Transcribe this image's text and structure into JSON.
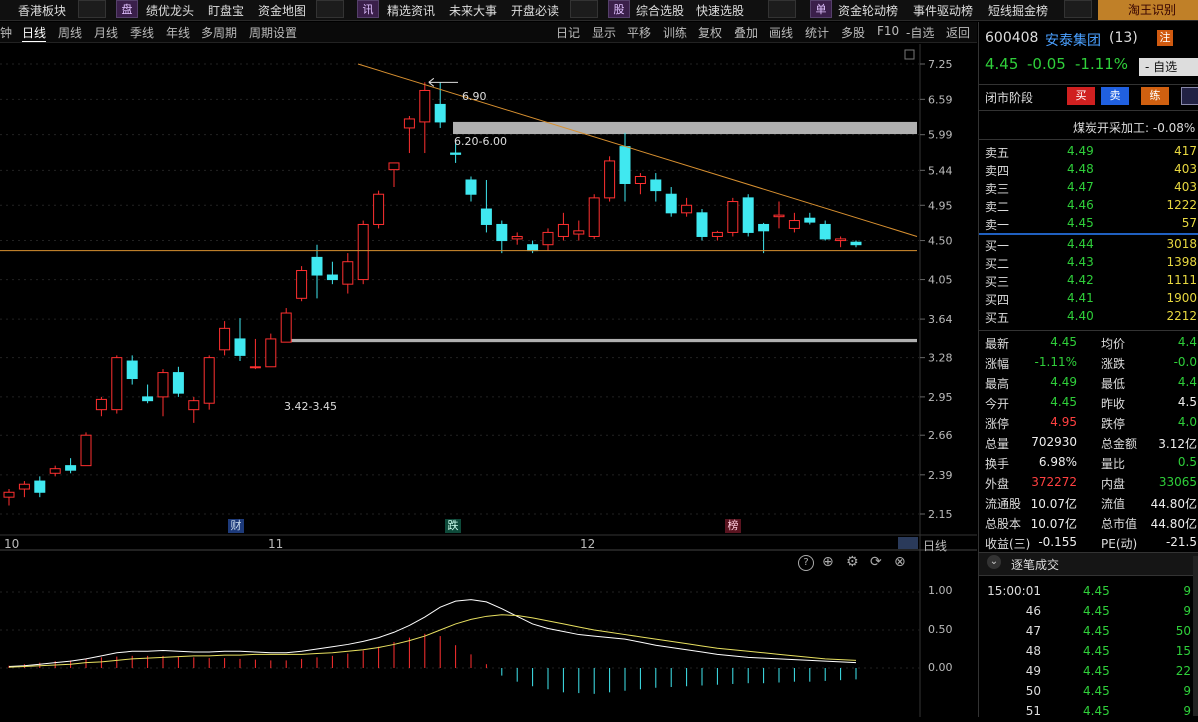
{
  "topbar": {
    "items": [
      {
        "label": "香港板块"
      },
      {
        "badge": "盘",
        "label": "绩优龙头"
      },
      {
        "label": "盯盘宝"
      },
      {
        "label": "资金地图"
      },
      {
        "badge": "讯",
        "label": "精选资讯"
      },
      {
        "label": "未来大事"
      },
      {
        "label": "开盘必读"
      },
      {
        "badge": "股",
        "label": "综合选股"
      },
      {
        "label": "快速选股"
      },
      {
        "badge": "单",
        "label": "资金轮动榜"
      },
      {
        "label": "事件驱动榜"
      },
      {
        "label": "短线掘金榜"
      },
      {
        "label": "淘王识别"
      }
    ]
  },
  "periodbar": {
    "left": [
      "钟",
      "日线",
      "周线",
      "月线",
      "季线",
      "年线",
      "多周期",
      "周期设置"
    ],
    "right": [
      "日记",
      "显示",
      "平移",
      "训练",
      "复权",
      "叠加",
      "画线",
      "统计",
      "多股",
      "F10",
      "-自选",
      "返回"
    ],
    "active": "日线"
  },
  "chart": {
    "price_axis": [
      "7.25",
      "6.59",
      "5.99",
      "5.44",
      "4.95",
      "4.50",
      "4.05",
      "3.64",
      "3.28",
      "2.95",
      "2.66",
      "2.39",
      "2.15"
    ],
    "annotations": {
      "high": "6.90",
      "zone_top": "6.20-6.00",
      "zone_bottom": "3.42-3.45"
    },
    "markers": [
      {
        "text": "财",
        "color": "#3060c0"
      },
      {
        "text": "跌",
        "color": "#208060"
      },
      {
        "text": "榜",
        "color": "#a02030"
      }
    ],
    "dates": [
      "10",
      "11",
      "12"
    ],
    "period_label": "日线",
    "macd_axis": [
      "1.00",
      "0.50",
      "0.00"
    ]
  },
  "chart_data": {
    "type": "candlestick",
    "ylim": [
      2.15,
      7.25
    ],
    "candles": [
      {
        "o": 2.25,
        "h": 2.3,
        "l": 2.2,
        "c": 2.28
      },
      {
        "o": 2.3,
        "h": 2.35,
        "l": 2.25,
        "c": 2.33
      },
      {
        "o": 2.35,
        "h": 2.38,
        "l": 2.25,
        "c": 2.28
      },
      {
        "o": 2.4,
        "h": 2.45,
        "l": 2.38,
        "c": 2.43
      },
      {
        "o": 2.45,
        "h": 2.5,
        "l": 2.4,
        "c": 2.42
      },
      {
        "o": 2.45,
        "h": 2.68,
        "l": 2.45,
        "c": 2.66
      },
      {
        "o": 2.85,
        "h": 2.95,
        "l": 2.8,
        "c": 2.93
      },
      {
        "o": 2.85,
        "h": 3.3,
        "l": 2.82,
        "c": 3.28
      },
      {
        "o": 3.25,
        "h": 3.3,
        "l": 3.05,
        "c": 3.1
      },
      {
        "o": 2.95,
        "h": 3.05,
        "l": 2.9,
        "c": 2.92
      },
      {
        "o": 2.95,
        "h": 3.18,
        "l": 2.8,
        "c": 3.15
      },
      {
        "o": 3.15,
        "h": 3.2,
        "l": 2.95,
        "c": 2.98
      },
      {
        "o": 2.85,
        "h": 2.95,
        "l": 2.75,
        "c": 2.92
      },
      {
        "o": 2.9,
        "h": 3.3,
        "l": 2.85,
        "c": 3.28
      },
      {
        "o": 3.35,
        "h": 3.62,
        "l": 3.3,
        "c": 3.55
      },
      {
        "o": 3.45,
        "h": 3.65,
        "l": 3.25,
        "c": 3.3
      },
      {
        "o": 3.2,
        "h": 3.45,
        "l": 3.18,
        "c": 3.2
      },
      {
        "o": 3.2,
        "h": 3.5,
        "l": 3.2,
        "c": 3.45
      },
      {
        "o": 3.42,
        "h": 3.75,
        "l": 3.42,
        "c": 3.7
      },
      {
        "o": 3.85,
        "h": 4.2,
        "l": 3.82,
        "c": 4.15
      },
      {
        "o": 4.3,
        "h": 4.45,
        "l": 3.85,
        "c": 4.1
      },
      {
        "o": 4.1,
        "h": 4.25,
        "l": 4.0,
        "c": 4.05
      },
      {
        "o": 4.0,
        "h": 4.35,
        "l": 3.9,
        "c": 4.25
      },
      {
        "o": 4.05,
        "h": 4.75,
        "l": 4.0,
        "c": 4.7
      },
      {
        "o": 4.7,
        "h": 5.15,
        "l": 4.65,
        "c": 5.1
      },
      {
        "o": 5.45,
        "h": 5.55,
        "l": 5.2,
        "c": 5.55
      },
      {
        "o": 6.1,
        "h": 6.3,
        "l": 5.7,
        "c": 6.25
      },
      {
        "o": 6.2,
        "h": 6.9,
        "l": 5.7,
        "c": 6.75
      },
      {
        "o": 6.5,
        "h": 6.9,
        "l": 6.1,
        "c": 6.2
      },
      {
        "o": 5.7,
        "h": 5.9,
        "l": 5.55,
        "c": 5.68
      },
      {
        "o": 5.3,
        "h": 5.35,
        "l": 5.0,
        "c": 5.1
      },
      {
        "o": 4.9,
        "h": 5.3,
        "l": 4.6,
        "c": 4.7
      },
      {
        "o": 4.7,
        "h": 4.75,
        "l": 4.35,
        "c": 4.5
      },
      {
        "o": 4.52,
        "h": 4.6,
        "l": 4.45,
        "c": 4.55
      },
      {
        "o": 4.45,
        "h": 4.5,
        "l": 4.35,
        "c": 4.38
      },
      {
        "o": 4.45,
        "h": 4.65,
        "l": 4.38,
        "c": 4.6
      },
      {
        "o": 4.55,
        "h": 4.85,
        "l": 4.5,
        "c": 4.7
      },
      {
        "o": 4.58,
        "h": 4.75,
        "l": 4.5,
        "c": 4.62
      },
      {
        "o": 4.55,
        "h": 5.1,
        "l": 4.52,
        "c": 5.05
      },
      {
        "o": 5.05,
        "h": 5.65,
        "l": 5.0,
        "c": 5.58
      },
      {
        "o": 5.8,
        "h": 6.02,
        "l": 5.0,
        "c": 5.25
      },
      {
        "o": 5.25,
        "h": 5.4,
        "l": 5.1,
        "c": 5.35
      },
      {
        "o": 5.3,
        "h": 5.4,
        "l": 5.0,
        "c": 5.15
      },
      {
        "o": 5.1,
        "h": 5.2,
        "l": 4.8,
        "c": 4.85
      },
      {
        "o": 4.85,
        "h": 5.05,
        "l": 4.8,
        "c": 4.95
      },
      {
        "o": 4.85,
        "h": 4.9,
        "l": 4.5,
        "c": 4.55
      },
      {
        "o": 4.55,
        "h": 4.62,
        "l": 4.5,
        "c": 4.6
      },
      {
        "o": 4.6,
        "h": 5.05,
        "l": 4.55,
        "c": 5.0
      },
      {
        "o": 5.05,
        "h": 5.1,
        "l": 4.55,
        "c": 4.6
      },
      {
        "o": 4.7,
        "h": 4.72,
        "l": 4.35,
        "c": 4.62
      },
      {
        "o": 4.8,
        "h": 5.0,
        "l": 4.65,
        "c": 4.82
      },
      {
        "o": 4.65,
        "h": 4.85,
        "l": 4.6,
        "c": 4.75
      },
      {
        "o": 4.78,
        "h": 4.85,
        "l": 4.7,
        "c": 4.73
      },
      {
        "o": 4.7,
        "h": 4.75,
        "l": 4.5,
        "c": 4.52
      },
      {
        "o": 4.5,
        "h": 4.55,
        "l": 4.42,
        "c": 4.52
      },
      {
        "o": 4.48,
        "h": 4.5,
        "l": 4.42,
        "c": 4.45
      }
    ],
    "macd_hist": [
      0.03,
      0.05,
      0.07,
      0.09,
      0.1,
      0.12,
      0.14,
      0.15,
      0.16,
      0.16,
      0.16,
      0.15,
      0.14,
      0.13,
      0.13,
      0.12,
      0.11,
      0.1,
      0.1,
      0.12,
      0.14,
      0.16,
      0.19,
      0.23,
      0.28,
      0.34,
      0.4,
      0.45,
      0.42,
      0.3,
      0.18,
      0.05,
      -0.1,
      -0.18,
      -0.24,
      -0.28,
      -0.32,
      -0.33,
      -0.34,
      -0.32,
      -0.3,
      -0.28,
      -0.26,
      -0.25,
      -0.24,
      -0.23,
      -0.22,
      -0.21,
      -0.2,
      -0.2,
      -0.19,
      -0.18,
      -0.18,
      -0.17,
      -0.16,
      -0.15
    ],
    "dif": [
      0.02,
      0.03,
      0.05,
      0.07,
      0.09,
      0.12,
      0.16,
      0.2,
      0.22,
      0.22,
      0.23,
      0.22,
      0.21,
      0.21,
      0.22,
      0.22,
      0.21,
      0.2,
      0.2,
      0.22,
      0.25,
      0.28,
      0.31,
      0.35,
      0.4,
      0.47,
      0.56,
      0.67,
      0.8,
      0.88,
      0.9,
      0.87,
      0.78,
      0.68,
      0.58,
      0.52,
      0.48,
      0.44,
      0.42,
      0.4,
      0.38,
      0.34,
      0.3,
      0.27,
      0.24,
      0.21,
      0.18,
      0.16,
      0.14,
      0.13,
      0.12,
      0.11,
      0.1,
      0.09,
      0.08,
      0.07
    ],
    "dea": [
      0.01,
      0.02,
      0.03,
      0.04,
      0.05,
      0.07,
      0.08,
      0.1,
      0.12,
      0.13,
      0.14,
      0.15,
      0.16,
      0.16,
      0.17,
      0.17,
      0.18,
      0.18,
      0.18,
      0.18,
      0.19,
      0.2,
      0.22,
      0.24,
      0.27,
      0.31,
      0.36,
      0.42,
      0.5,
      0.58,
      0.64,
      0.68,
      0.7,
      0.69,
      0.66,
      0.62,
      0.58,
      0.54,
      0.5,
      0.47,
      0.44,
      0.41,
      0.38,
      0.35,
      0.32,
      0.29,
      0.26,
      0.24,
      0.22,
      0.2,
      0.18,
      0.16,
      0.14,
      0.12,
      0.11,
      0.1
    ]
  },
  "quote": {
    "code": "600408",
    "name": "安泰集团",
    "count": "(13)",
    "badge": "注",
    "price": "4.45",
    "change": "-0.05",
    "pct": "-1.11%",
    "watch_btn": "- 自选",
    "phase": "闭市阶段",
    "buy": "买",
    "sell": "卖",
    "practice": "练",
    "industry": "煤炭开采加工: -0.08%"
  },
  "orderbook": {
    "asks": [
      {
        "label": "卖五",
        "price": "4.49",
        "vol": "417"
      },
      {
        "label": "卖四",
        "price": "4.48",
        "vol": "403"
      },
      {
        "label": "卖三",
        "price": "4.47",
        "vol": "403"
      },
      {
        "label": "卖二",
        "price": "4.46",
        "vol": "1222"
      },
      {
        "label": "卖一",
        "price": "4.45",
        "vol": "57"
      }
    ],
    "bids": [
      {
        "label": "买一",
        "price": "4.44",
        "vol": "3018"
      },
      {
        "label": "买二",
        "price": "4.43",
        "vol": "1398"
      },
      {
        "label": "买三",
        "price": "4.42",
        "vol": "1111"
      },
      {
        "label": "买四",
        "price": "4.41",
        "vol": "1900"
      },
      {
        "label": "买五",
        "price": "4.40",
        "vol": "2212"
      }
    ]
  },
  "stats": [
    {
      "l1": "最新",
      "v1": "4.45",
      "c1": "green",
      "l2": "均价",
      "v2": "4.4",
      "c2": "green"
    },
    {
      "l1": "涨幅",
      "v1": "-1.11%",
      "c1": "green",
      "l2": "涨跌",
      "v2": "-0.0",
      "c2": "green"
    },
    {
      "l1": "最高",
      "v1": "4.49",
      "c1": "green",
      "l2": "最低",
      "v2": "4.4",
      "c2": "green"
    },
    {
      "l1": "今开",
      "v1": "4.45",
      "c1": "green",
      "l2": "昨收",
      "v2": "4.5",
      "c2": "white"
    },
    {
      "l1": "涨停",
      "v1": "4.95",
      "c1": "red",
      "l2": "跌停",
      "v2": "4.0",
      "c2": "green"
    },
    {
      "l1": "总量",
      "v1": "702930",
      "c1": "white",
      "l2": "总金额",
      "v2": "3.12亿",
      "c2": "white"
    },
    {
      "l1": "换手",
      "v1": "6.98%",
      "c1": "white",
      "l2": "量比",
      "v2": "0.5",
      "c2": "green"
    },
    {
      "l1": "外盘",
      "v1": "372272",
      "c1": "red",
      "l2": "内盘",
      "v2": "33065",
      "c2": "green"
    },
    {
      "l1": "流通股",
      "v1": "10.07亿",
      "c1": "white",
      "l2": "流值",
      "v2": "44.80亿",
      "c2": "white"
    },
    {
      "l1": "总股本",
      "v1": "10.07亿",
      "c1": "white",
      "l2": "总市值",
      "v2": "44.80亿",
      "c2": "white"
    },
    {
      "l1": "收益(三)",
      "v1": "-0.155",
      "c1": "white",
      "l2": "PE(动)",
      "v2": "-21.5",
      "c2": "white"
    }
  ],
  "ticks": {
    "title": "逐笔成交",
    "rows": [
      {
        "t": "15:00:01",
        "p": "4.45",
        "v": "9"
      },
      {
        "t": "46",
        "p": "4.45",
        "v": "9"
      },
      {
        "t": "47",
        "p": "4.45",
        "v": "50"
      },
      {
        "t": "48",
        "p": "4.45",
        "v": "15"
      },
      {
        "t": "49",
        "p": "4.45",
        "v": "22"
      },
      {
        "t": "50",
        "p": "4.45",
        "v": "9"
      },
      {
        "t": "51",
        "p": "4.45",
        "v": "9"
      }
    ]
  },
  "colors": {
    "up": "#ff3030",
    "down": "#40e8f0",
    "trend": "#d89030",
    "zone": "#b0b0b0"
  }
}
